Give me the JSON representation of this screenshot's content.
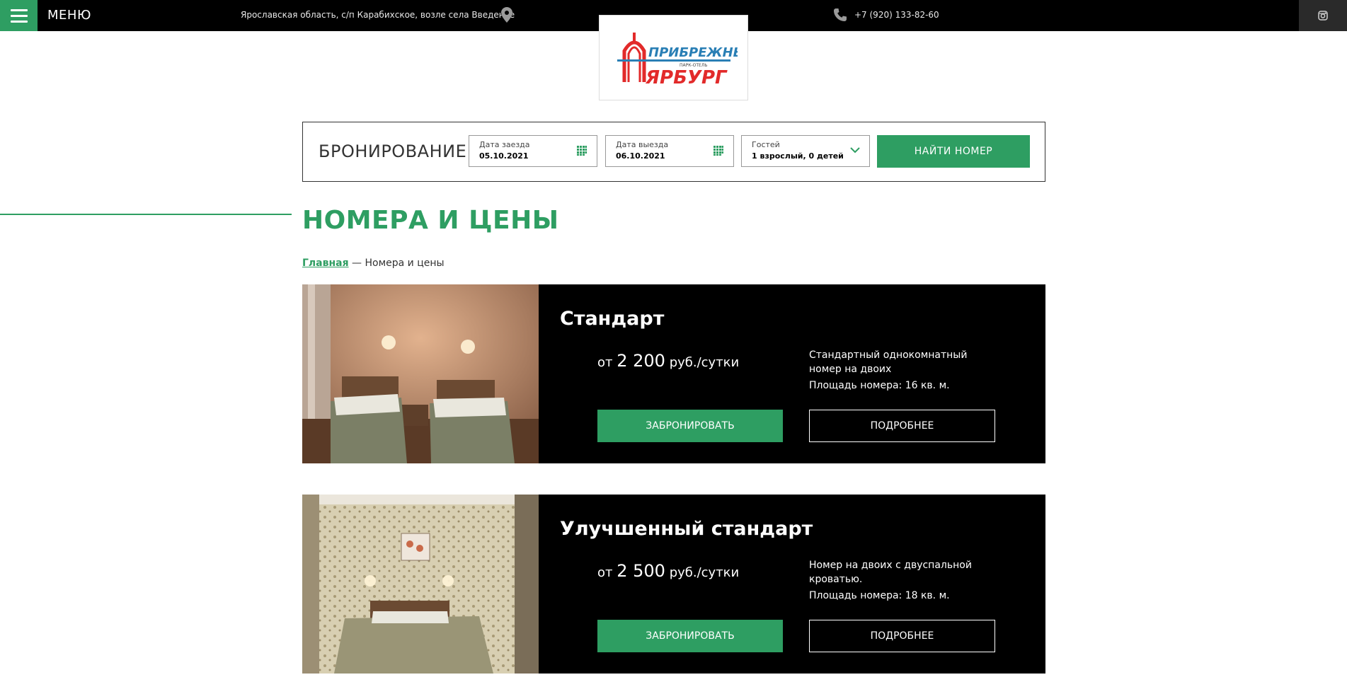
{
  "header": {
    "menu_label": "МЕНЮ",
    "address": "Ярославская область, с/п Карабихское, возле села Введенье",
    "phone": "+7 (920) 133-82-60"
  },
  "logo": {
    "line1": "ПРИБРЕЖНЫЙ",
    "line2": "ПАРК-ОТЕЛЬ",
    "line3": "ЯРБУРГ"
  },
  "booking": {
    "title": "БРОНИРОВАНИЕ",
    "checkin_label": "Дата заезда",
    "checkin_value": "05.10.2021",
    "checkout_label": "Дата выезда",
    "checkout_value": "06.10.2021",
    "guests_label": "Гостей",
    "guests_value": "1 взрослый, 0 детей",
    "find_label": "НАЙТИ НОМЕР"
  },
  "page": {
    "title": "НОМЕРА И ЦЕНЫ",
    "breadcrumb_home": "Главная",
    "breadcrumb_current": "— Номера и цены"
  },
  "rooms": [
    {
      "name": "Стандарт",
      "price_prefix": "от",
      "price_value": "2 200",
      "price_unit": "руб./сутки",
      "description": "Стандартный однокомнатный номер на двоих",
      "area": "Площадь номера: 16 кв. м.",
      "book_label": "ЗАБРОНИРОВАТЬ",
      "more_label": "ПОДРОБНЕЕ"
    },
    {
      "name": "Улучшенный стандарт",
      "price_prefix": "от",
      "price_value": "2 500",
      "price_unit": "руб./сутки",
      "description": "Номер на двоих с двуспальной кроватью.",
      "area": "Площадь номера: 18 кв. м.",
      "book_label": "ЗАБРОНИРОВАТЬ",
      "more_label": "ПОДРОБНЕЕ"
    }
  ],
  "colors": {
    "accent": "#2e9e62",
    "topbar": "#000000",
    "card": "#000000"
  }
}
